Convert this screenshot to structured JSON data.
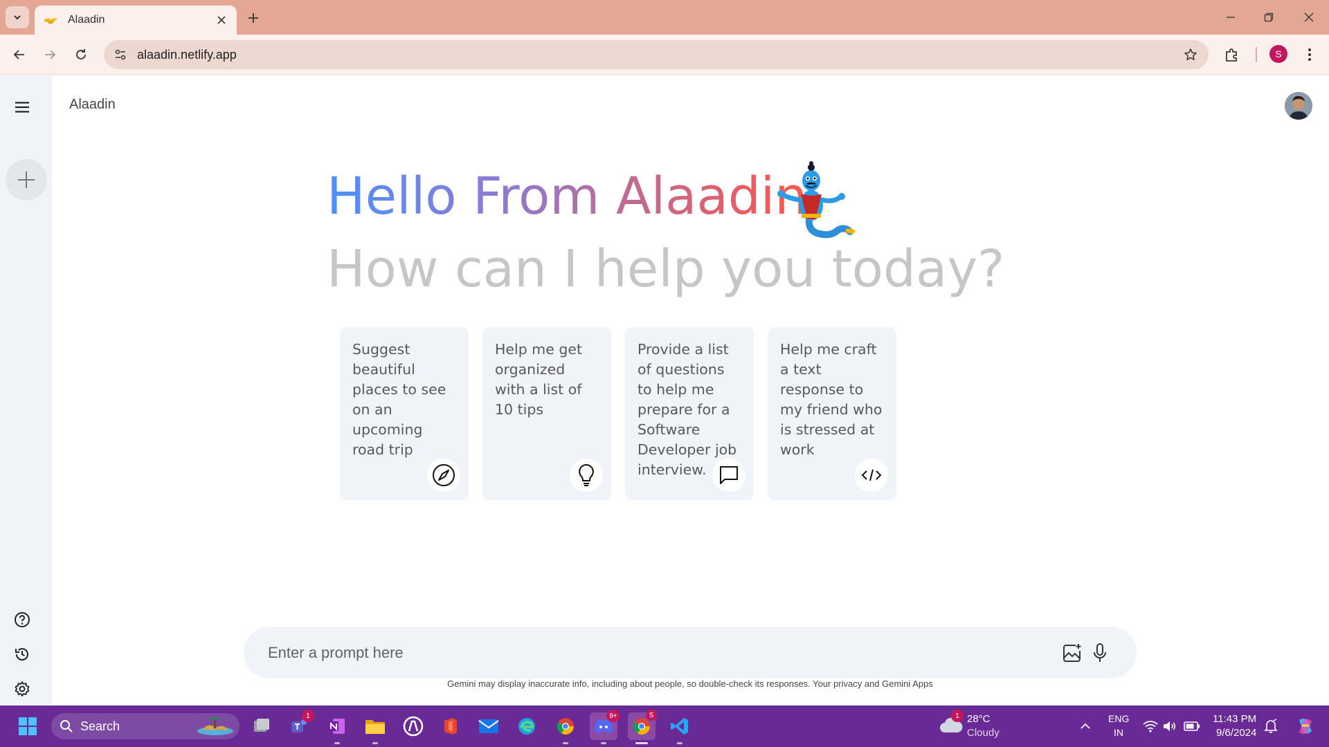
{
  "browser": {
    "tab_title": "Alaadin",
    "url": "alaadin.netlify.app",
    "profile_initial": "S"
  },
  "app": {
    "title": "Alaadin",
    "greeting": "Hello From Alaadin.",
    "subtitle": "How can I help you today?",
    "cards": [
      {
        "text": "Suggest beautiful places to see on an upcoming road trip",
        "icon": "compass-icon"
      },
      {
        "text": "Help me get organized with a list of 10 tips",
        "icon": "lightbulb-icon"
      },
      {
        "text": "Provide a list of questions to help me prepare for a Software Developer job interview.",
        "icon": "message-icon"
      },
      {
        "text": "Help me craft a text response to my friend who is stressed at work",
        "icon": "code-icon"
      }
    ],
    "prompt_placeholder": "Enter a prompt here",
    "disclaimer": "Gemini may display inaccurate info, including about people, so double-check its responses. Your privacy and Gemini Apps"
  },
  "taskbar": {
    "search_label": "Search",
    "teams_badge": "1",
    "discord_badge": "9+",
    "chrome_badge": "S",
    "weather_badge": "1",
    "temperature": "28°C",
    "weather": "Cloudy",
    "lang_top": "ENG",
    "lang_bottom": "IN",
    "time": "11:43 PM",
    "date": "9/6/2024"
  },
  "colors": {
    "tabbar": "#e3a795",
    "toolbar": "#fbf0ec",
    "sidebar": "#f0f4f9",
    "taskbar": "#6a2a95",
    "gradient_start": "#4b90ff",
    "gradient_end": "#ff5546"
  }
}
